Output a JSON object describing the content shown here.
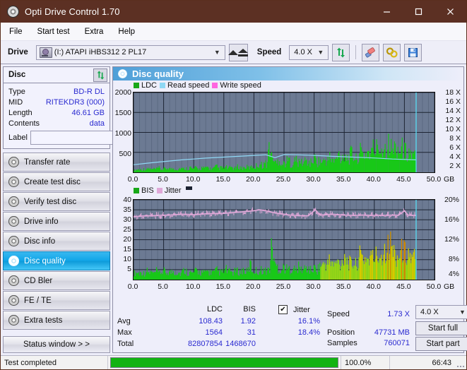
{
  "window": {
    "title": "Opti Drive Control 1.70",
    "icon": "disc-icon",
    "minimize": "–",
    "maximize": "□",
    "close": "✕"
  },
  "menu": [
    "File",
    "Start test",
    "Extra",
    "Help"
  ],
  "toolbar": {
    "drive_label": "Drive",
    "drive_value": "(I:)  ATAPI iHBS312  2 PL17",
    "eject": "eject-icon",
    "speed_label": "Speed",
    "speed_value": "4.0 X",
    "refresh": "refresh-icon",
    "erase": "eraser-icon",
    "tools": "tools-icon",
    "save": "save-icon"
  },
  "sidebar": {
    "disc_panel": {
      "title": "Disc",
      "refresh": "refresh-icon",
      "rows": [
        {
          "key": "Type",
          "value": "BD-R DL"
        },
        {
          "key": "MID",
          "value": "RITEKDR3 (000)"
        },
        {
          "key": "Length",
          "value": "46.61 GB"
        },
        {
          "key": "Contents",
          "value": "data"
        }
      ],
      "label_key": "Label",
      "label_value": "",
      "label_placeholder": ""
    },
    "nav": [
      {
        "label": "Transfer rate",
        "active": false
      },
      {
        "label": "Create test disc",
        "active": false
      },
      {
        "label": "Verify test disc",
        "active": false
      },
      {
        "label": "Drive info",
        "active": false
      },
      {
        "label": "Disc info",
        "active": false
      },
      {
        "label": "Disc quality",
        "active": true
      },
      {
        "label": "CD Bler",
        "active": false
      },
      {
        "label": "FE / TE",
        "active": false
      },
      {
        "label": "Extra tests",
        "active": false
      }
    ],
    "status_window_button": "Status window > >"
  },
  "content": {
    "header_title": "Disc quality",
    "header_icon": "disc-icon"
  },
  "stats": {
    "col_ldc": "LDC",
    "col_bis": "BIS",
    "row_avg": "Avg",
    "row_max": "Max",
    "row_total": "Total",
    "avg_ldc": "108.43",
    "avg_bis": "1.92",
    "max_ldc": "1564",
    "max_bis": "31",
    "total_ldc": "82807854",
    "total_bis": "1468670",
    "jitter_label": "Jitter",
    "jitter_checked": "✔",
    "jitter_avg": "16.1%",
    "jitter_max": "18.4%",
    "speed_label": "Speed",
    "speed_value": "1.73 X",
    "position_label": "Position",
    "position_value": "47731 MB",
    "samples_label": "Samples",
    "samples_value": "760071",
    "speed_select": "4.0 X",
    "start_full": "Start full",
    "start_part": "Start part"
  },
  "statusbar": {
    "message": "Test completed",
    "percent_text": "100.0%",
    "percent_value": 100,
    "time": "66:43"
  },
  "colors": {
    "titlebar": "#5c3023",
    "accent": "#11a6e8",
    "ldc_green": "#18c818",
    "read_speed": "#8fd8f4",
    "write_speed": "#ff66e0",
    "bis_green": "#18c818",
    "jitter_pink": "#e0a8d8",
    "plot_bg": "#6c7a93",
    "progress_green": "#12b312",
    "value_blue": "#2a2ad0"
  },
  "chart_data": [
    {
      "type": "area",
      "name": "ldc-chart",
      "title": "",
      "xlabel": "GB",
      "ylabel": "",
      "xlim": [
        0,
        50
      ],
      "ylim": [
        0,
        2000
      ],
      "y2lim": [
        0,
        18
      ],
      "y2label": "X",
      "xticks": [
        "0.0",
        "5.0",
        "10.0",
        "15.0",
        "20.0",
        "25.0",
        "30.0",
        "35.0",
        "40.0",
        "45.0",
        "50.0"
      ],
      "yticks": [
        500,
        1000,
        1500,
        2000
      ],
      "y2ticks": [
        2,
        4,
        6,
        8,
        10,
        12,
        14,
        16,
        18
      ],
      "x_unit_label": "GB",
      "grid": true,
      "legend": [
        {
          "label": "LDC",
          "color": "#18c818"
        },
        {
          "label": "Read speed",
          "color": "#8fd8f4"
        },
        {
          "label": "Write speed",
          "color": "#ff66e0"
        }
      ],
      "series": [
        {
          "name": "LDC",
          "color": "#18c818",
          "kind": "spikes",
          "x": [
            0.2,
            0.6,
            1.0,
            1.4,
            1.8,
            2.2,
            2.6,
            3.0,
            3.4,
            3.8,
            4.2,
            4.6,
            5.0,
            5.4,
            5.8,
            6.2,
            6.6,
            7.0,
            7.4,
            7.8,
            8.2,
            8.6,
            9.0,
            9.4,
            9.8,
            10.2,
            10.6,
            11.0,
            11.4,
            11.8,
            12.2,
            12.6,
            13.0,
            13.4,
            13.8,
            14.2,
            14.6,
            15.0,
            15.4,
            15.8,
            16.2,
            16.6,
            17.0,
            17.4,
            17.8,
            18.2,
            18.6,
            19.0,
            19.4,
            19.8,
            20.2,
            20.6,
            21.0,
            21.4,
            21.8,
            22.2,
            22.6,
            23.0,
            23.2,
            23.4,
            23.8,
            24.2,
            24.6,
            25.0,
            25.4,
            25.8,
            26.2,
            26.6,
            27.0,
            27.4,
            27.8,
            28.2,
            28.6,
            29.0,
            29.4,
            29.8,
            30.2,
            30.6,
            31.0,
            31.4,
            31.8,
            32.2,
            32.6,
            33.0,
            33.4,
            33.8,
            34.2,
            34.6,
            35.0,
            35.4,
            35.8,
            36.2,
            36.6,
            37.0,
            37.4,
            37.8,
            38.2,
            38.6,
            39.0,
            39.4,
            39.8,
            40.2,
            40.6,
            41.0,
            41.4,
            41.8,
            42.2,
            42.6,
            43.0,
            43.4,
            43.8,
            44.2,
            44.6,
            45.0,
            45.4,
            45.8,
            46.2,
            46.6,
            46.9
          ],
          "y": [
            70,
            95,
            110,
            85,
            120,
            100,
            140,
            90,
            115,
            105,
            150,
            95,
            125,
            110,
            170,
            100,
            135,
            120,
            95,
            160,
            110,
            140,
            125,
            180,
            105,
            150,
            130,
            110,
            165,
            120,
            190,
            135,
            115,
            145,
            200,
            125,
            160,
            140,
            175,
            120,
            190,
            145,
            130,
            210,
            155,
            140,
            185,
            165,
            150,
            220,
            170,
            260,
            290,
            240,
            310,
            280,
            1020,
            420,
            640,
            350,
            300,
            520,
            270,
            300,
            360,
            420,
            280,
            330,
            450,
            300,
            380,
            310,
            420,
            350,
            300,
            420,
            480,
            360,
            400,
            320,
            450,
            380,
            520,
            430,
            360,
            500,
            620,
            450,
            700,
            540,
            480,
            650,
            560,
            430,
            620,
            700,
            580,
            660,
            740,
            600,
            820,
            700,
            980,
            760,
            900,
            820,
            1010,
            880,
            760,
            840,
            900,
            700,
            820,
            760,
            640,
            720,
            600,
            540
          ]
        },
        {
          "name": "Read speed",
          "color": "#8fd8f4",
          "kind": "line",
          "x": [
            0.0,
            2.0,
            4.0,
            6.0,
            8.0,
            10.0,
            12.0,
            14.0,
            16.0,
            18.0,
            20.0,
            22.0,
            23.5,
            25.0,
            27.0,
            29.0,
            31.0,
            33.0,
            35.0,
            37.0,
            39.0,
            41.0,
            43.0,
            45.0,
            46.9
          ],
          "y": [
            1.7,
            2.0,
            2.3,
            2.55,
            2.8,
            3.0,
            3.2,
            3.35,
            3.5,
            3.65,
            3.8,
            3.95,
            3.3,
            4.0,
            3.95,
            3.85,
            3.75,
            3.6,
            3.5,
            3.4,
            3.3,
            3.15,
            3.0,
            2.9,
            2.8
          ],
          "axis": "y2"
        },
        {
          "name": "cursor",
          "color": "#5ce0f8",
          "kind": "vline",
          "x": 46.95
        }
      ]
    },
    {
      "type": "area",
      "name": "bis-jitter-chart",
      "title": "",
      "xlabel": "GB",
      "ylabel": "",
      "xlim": [
        0,
        50
      ],
      "ylim": [
        0,
        40
      ],
      "y2lim": [
        0,
        20
      ],
      "y2label": "%",
      "xticks": [
        "0.0",
        "5.0",
        "10.0",
        "15.0",
        "20.0",
        "25.0",
        "30.0",
        "35.0",
        "40.0",
        "45.0",
        "50.0"
      ],
      "yticks": [
        5,
        10,
        15,
        20,
        25,
        30,
        35,
        40
      ],
      "y2ticks": [
        "4%",
        "8%",
        "12%",
        "16%",
        "20%"
      ],
      "x_unit_label": "GB",
      "grid": true,
      "legend": [
        {
          "label": "BIS",
          "color": "#18c818"
        },
        {
          "label": "Jitter",
          "color": "#e0a8d8"
        }
      ],
      "series": [
        {
          "name": "BIS",
          "color": "#18c818",
          "kind": "spikes",
          "x": [
            0.2,
            0.6,
            1.0,
            1.4,
            1.8,
            2.2,
            2.6,
            3.0,
            3.4,
            3.8,
            4.2,
            4.6,
            5.0,
            5.4,
            5.8,
            6.2,
            6.6,
            7.0,
            7.4,
            7.8,
            8.2,
            8.6,
            9.0,
            9.4,
            9.8,
            10.2,
            10.6,
            11.0,
            11.4,
            11.8,
            12.2,
            12.6,
            13.0,
            13.4,
            13.8,
            14.2,
            14.6,
            15.0,
            15.4,
            15.8,
            16.2,
            16.6,
            17.0,
            17.4,
            17.8,
            18.2,
            18.6,
            19.0,
            19.4,
            19.8,
            20.2,
            20.6,
            21.0,
            21.4,
            21.8,
            22.2,
            22.6,
            23.0,
            23.4,
            23.5,
            23.8,
            24.2,
            24.6,
            25.0,
            25.4,
            25.8,
            26.2,
            26.6,
            27.0,
            27.4,
            27.8,
            28.2,
            28.6,
            29.0,
            29.4,
            29.8,
            30.2,
            30.6,
            31.0,
            31.4,
            31.8,
            32.2,
            32.6,
            33.0,
            33.4,
            33.8,
            34.2,
            34.6,
            35.0,
            35.4,
            35.8,
            36.2,
            36.6,
            37.0,
            37.4,
            37.8,
            38.2,
            38.6,
            39.0,
            39.4,
            39.8,
            40.2,
            40.6,
            41.0,
            41.4,
            41.8,
            42.0,
            42.4,
            42.8,
            43.2,
            43.6,
            44.0,
            44.4,
            44.8,
            45.2,
            45.6,
            46.0,
            46.4,
            46.8
          ],
          "y": [
            4.5,
            5.0,
            4.2,
            5.5,
            4.0,
            6.0,
            4.5,
            5.2,
            3.8,
            5.8,
            4.4,
            5.0,
            6.2,
            4.2,
            5.5,
            4.8,
            6.0,
            4.5,
            5.2,
            4.0,
            5.8,
            6.5,
            4.6,
            5.0,
            4.2,
            5.6,
            6.0,
            4.8,
            5.2,
            4.4,
            6.2,
            5.0,
            5.5,
            4.6,
            6.5,
            5.2,
            4.8,
            5.5,
            7.0,
            5.0,
            5.8,
            4.6,
            6.2,
            5.4,
            5.0,
            6.8,
            5.6,
            5.2,
            11.0,
            5.8,
            6.5,
            5.4,
            6.0,
            7.2,
            5.8,
            6.4,
            7.0,
            24.0,
            14.0,
            8.5,
            9.5,
            7.0,
            6.5,
            9.0,
            7.2,
            6.8,
            8.0,
            7.5,
            6.2,
            8.5,
            7.0,
            6.5,
            8.2,
            7.8,
            6.4,
            7.0,
            8.0,
            6.8,
            10.5,
            9.0,
            11.5,
            10.0,
            13.5,
            11.0,
            9.5,
            12.5,
            10.5,
            11.0,
            19.5,
            13.5,
            11.5,
            10.0,
            12.0,
            9.5,
            15.0,
            16.5,
            14.0,
            15.5,
            13.5,
            16.0,
            14.5,
            17.0,
            15.0,
            18.5,
            16.0,
            22.0,
            25.0,
            21.0,
            24.5,
            19.0,
            16.5,
            15.5,
            18.0,
            21.5,
            17.0,
            19.5,
            15.0,
            13.5,
            16.0
          ]
        },
        {
          "name": "Jitter",
          "color": "#e0a8d8",
          "kind": "line",
          "x": [
            0.0,
            1.0,
            2.0,
            3.0,
            4.0,
            5.0,
            6.0,
            7.0,
            8.0,
            9.0,
            10.0,
            11.0,
            12.0,
            13.0,
            14.0,
            15.0,
            16.0,
            17.0,
            18.0,
            19.0,
            20.0,
            20.8,
            21.5,
            22.2,
            23.0,
            24.0,
            25.0,
            26.0,
            27.0,
            28.0,
            29.0,
            30.2,
            31.0,
            32.0,
            33.0,
            34.0,
            35.0,
            36.0,
            37.0,
            38.0,
            39.0,
            40.0,
            41.0,
            42.0,
            43.0,
            44.0,
            45.0,
            45.6,
            46.2,
            46.9
          ],
          "y": [
            31.5,
            31.8,
            32.0,
            32.0,
            32.2,
            32.3,
            32.4,
            32.6,
            32.8,
            32.7,
            32.6,
            32.8,
            33.0,
            33.1,
            33.2,
            33.3,
            33.5,
            33.8,
            34.0,
            34.3,
            34.6,
            35.0,
            34.8,
            34.4,
            33.8,
            33.2,
            32.8,
            32.4,
            32.2,
            32.0,
            32.0,
            35.0,
            32.4,
            32.6,
            32.8,
            32.6,
            32.4,
            32.3,
            32.2,
            32.4,
            32.3,
            32.2,
            32.3,
            32.2,
            32.4,
            32.3,
            34.5,
            32.4,
            32.3,
            32.2
          ],
          "axis": "y1"
        },
        {
          "name": "cursor",
          "color": "#5ce0f8",
          "kind": "vline",
          "x": 46.95
        }
      ]
    }
  ]
}
